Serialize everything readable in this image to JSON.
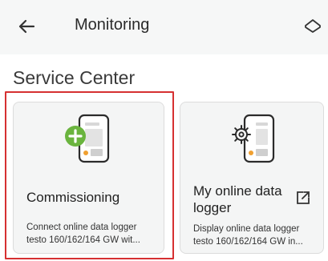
{
  "header": {
    "title": "Monitoring",
    "back_icon": "arrow-left-icon",
    "home_icon": "home-icon"
  },
  "section": {
    "title": "Service Center"
  },
  "cards": [
    {
      "title": "Commissioning",
      "desc_line1": "Connect online data logger",
      "desc_line2": "testo 160/162/164 GW wit...",
      "icon": "phone-add-icon",
      "highlighted": true
    },
    {
      "title": "My online data logger",
      "desc_line1": "Display online data logger",
      "desc_line2": "testo 160/162/164 GW in...",
      "icon": "phone-settings-icon",
      "external_icon": "external-link-icon"
    }
  ],
  "colors": {
    "accent_green": "#6ab43e",
    "accent_orange": "#f0a030",
    "highlight_red": "#d63031"
  }
}
